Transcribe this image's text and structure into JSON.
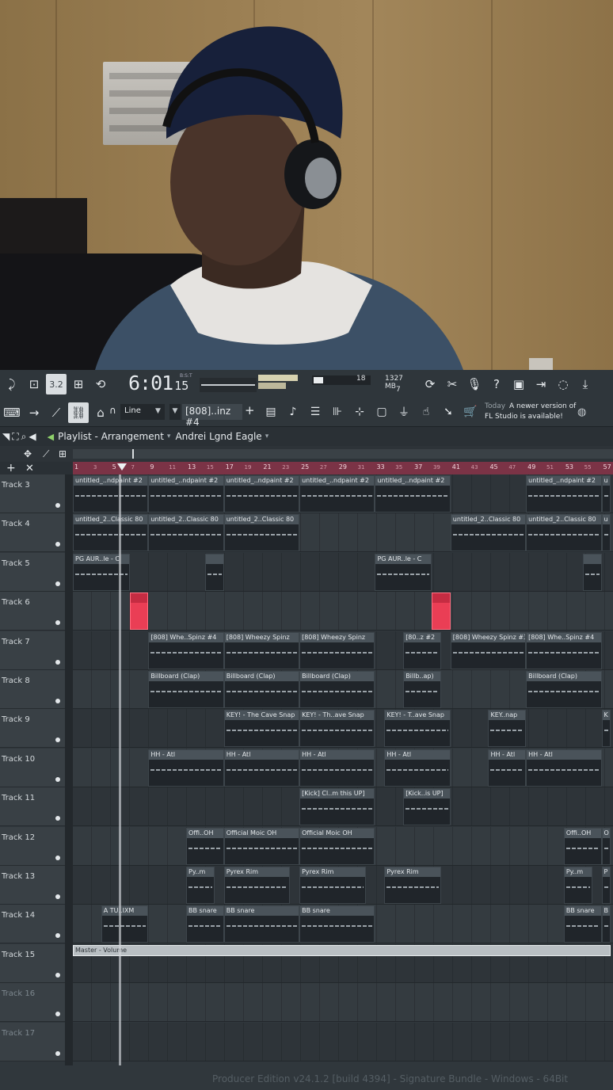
{
  "toolbar": {
    "time_main": "6:01",
    "time_sub": "15",
    "time_tag": "B:S:T",
    "cpu_voices": "18",
    "ram": "1327 MB",
    "poly": "7",
    "snap": "Line",
    "pattern": "[808]..inz #4",
    "news_date": "Today",
    "news_text": "A newer version of FL Studio is available!"
  },
  "playlist": {
    "title": "Playlist - Arrangement",
    "pattern_name": "Andrei Lgnd Eagle",
    "status": "Producer Edition v24.1.2 [build 4394] - Signature Bundle - Windows - 64Bit"
  },
  "ruler": [
    "1",
    "3",
    "5",
    "7",
    "9",
    "11",
    "13",
    "15",
    "17",
    "19",
    "21",
    "23",
    "25",
    "27",
    "29",
    "31",
    "33",
    "35",
    "37",
    "39",
    "41",
    "43",
    "45",
    "47",
    "49",
    "51",
    "53",
    "55",
    "57"
  ],
  "tracks": [
    {
      "name": "Track 3"
    },
    {
      "name": "Track 4"
    },
    {
      "name": "Track 5"
    },
    {
      "name": "Track 6"
    },
    {
      "name": "Track 7"
    },
    {
      "name": "Track 8"
    },
    {
      "name": "Track 9"
    },
    {
      "name": "Track 10"
    },
    {
      "name": "Track 11"
    },
    {
      "name": "Track 12"
    },
    {
      "name": "Track 13"
    },
    {
      "name": "Track 14"
    },
    {
      "name": "Track 15"
    },
    {
      "name": "Track 16"
    },
    {
      "name": "Track 17"
    }
  ],
  "clips": [
    {
      "t": 0,
      "bar": 1,
      "len": 8,
      "label": "untitled_..ndpaint #2"
    },
    {
      "t": 0,
      "bar": 9,
      "len": 8,
      "label": "untitled_..ndpaint #2"
    },
    {
      "t": 0,
      "bar": 17,
      "len": 8,
      "label": "untitled_..ndpaint #2"
    },
    {
      "t": 0,
      "bar": 25,
      "len": 8,
      "label": "untitled_..ndpaint #2"
    },
    {
      "t": 0,
      "bar": 33,
      "len": 8,
      "label": "untitled_..ndpaint #2"
    },
    {
      "t": 0,
      "bar": 49,
      "len": 8,
      "label": "untitled_..ndpaint #2"
    },
    {
      "t": 0,
      "bar": 57,
      "len": 1,
      "label": "u"
    },
    {
      "t": 1,
      "bar": 1,
      "len": 8,
      "label": "untitled_2..Classic 80"
    },
    {
      "t": 1,
      "bar": 9,
      "len": 8,
      "label": "untitled_2..Classic 80"
    },
    {
      "t": 1,
      "bar": 17,
      "len": 8,
      "label": "untitled_2..Classic 80"
    },
    {
      "t": 1,
      "bar": 41,
      "len": 8,
      "label": "untitled_2..Classic 80"
    },
    {
      "t": 1,
      "bar": 49,
      "len": 8,
      "label": "untitled_2..Classic 80"
    },
    {
      "t": 1,
      "bar": 57,
      "len": 1,
      "label": "u"
    },
    {
      "t": 2,
      "bar": 1,
      "len": 6,
      "label": "PG AUR..le - C"
    },
    {
      "t": 2,
      "bar": 15,
      "len": 2,
      "label": ""
    },
    {
      "t": 2,
      "bar": 33,
      "len": 6,
      "label": "PG AUR..le - C"
    },
    {
      "t": 2,
      "bar": 55,
      "len": 2,
      "label": ""
    },
    {
      "t": 3,
      "bar": 7,
      "len": 2,
      "label": "",
      "red": true
    },
    {
      "t": 3,
      "bar": 39,
      "len": 2,
      "label": "",
      "red": true
    },
    {
      "t": 4,
      "bar": 9,
      "len": 8,
      "label": "[808] Whe..Spinz #4"
    },
    {
      "t": 4,
      "bar": 17,
      "len": 8,
      "label": "[808] Wheezy Spinz"
    },
    {
      "t": 4,
      "bar": 25,
      "len": 8,
      "label": "[808] Wheezy Spinz"
    },
    {
      "t": 4,
      "bar": 36,
      "len": 4,
      "label": "[80..z #2"
    },
    {
      "t": 4,
      "bar": 41,
      "len": 8,
      "label": "[808] Wheezy Spinz #3"
    },
    {
      "t": 4,
      "bar": 49,
      "len": 8,
      "label": "[808] Whe..Spinz #4"
    },
    {
      "t": 5,
      "bar": 9,
      "len": 8,
      "label": "Billboard (Clap)"
    },
    {
      "t": 5,
      "bar": 17,
      "len": 8,
      "label": "Billboard (Clap)"
    },
    {
      "t": 5,
      "bar": 25,
      "len": 8,
      "label": "Billboard (Clap)"
    },
    {
      "t": 5,
      "bar": 36,
      "len": 4,
      "label": "Billb..ap)"
    },
    {
      "t": 5,
      "bar": 49,
      "len": 8,
      "label": "Billboard (Clap)"
    },
    {
      "t": 6,
      "bar": 17,
      "len": 8,
      "label": "KEY! - The Cave Snap"
    },
    {
      "t": 6,
      "bar": 25,
      "len": 8,
      "label": "KEY! - Th..ave Snap"
    },
    {
      "t": 6,
      "bar": 34,
      "len": 7,
      "label": "KEY! - T..ave Snap"
    },
    {
      "t": 6,
      "bar": 45,
      "len": 4,
      "label": "KEY..nap"
    },
    {
      "t": 6,
      "bar": 57,
      "len": 1,
      "label": "K"
    },
    {
      "t": 7,
      "bar": 9,
      "len": 8,
      "label": "HH - Atl"
    },
    {
      "t": 7,
      "bar": 17,
      "len": 8,
      "label": "HH - Atl"
    },
    {
      "t": 7,
      "bar": 25,
      "len": 8,
      "label": "HH - Atl"
    },
    {
      "t": 7,
      "bar": 34,
      "len": 7,
      "label": "HH - Atl"
    },
    {
      "t": 7,
      "bar": 45,
      "len": 4,
      "label": "HH - Atl"
    },
    {
      "t": 7,
      "bar": 49,
      "len": 8,
      "label": "HH - Atl"
    },
    {
      "t": 8,
      "bar": 25,
      "len": 8,
      "label": "[Kick] Cl..m this UP]"
    },
    {
      "t": 8,
      "bar": 36,
      "len": 5,
      "label": "[Kick..is UP]"
    },
    {
      "t": 9,
      "bar": 13,
      "len": 4,
      "label": "Offi..OH"
    },
    {
      "t": 9,
      "bar": 17,
      "len": 8,
      "label": "Official Moic OH"
    },
    {
      "t": 9,
      "bar": 25,
      "len": 8,
      "label": "Official Moic OH"
    },
    {
      "t": 9,
      "bar": 53,
      "len": 4,
      "label": "Offi..OH"
    },
    {
      "t": 9,
      "bar": 57,
      "len": 1,
      "label": "O"
    },
    {
      "t": 10,
      "bar": 13,
      "len": 3,
      "label": "Py..m"
    },
    {
      "t": 10,
      "bar": 17,
      "len": 7,
      "label": "Pyrex Rim"
    },
    {
      "t": 10,
      "bar": 25,
      "len": 7,
      "label": "Pyrex Rim"
    },
    {
      "t": 10,
      "bar": 34,
      "len": 6,
      "label": "Pyrex Rim"
    },
    {
      "t": 10,
      "bar": 53,
      "len": 3,
      "label": "Py..m"
    },
    {
      "t": 10,
      "bar": 57,
      "len": 1,
      "label": "P"
    },
    {
      "t": 11,
      "bar": 4,
      "len": 5,
      "label": "A TU..IXM"
    },
    {
      "t": 11,
      "bar": 13,
      "len": 4,
      "label": "BB snare"
    },
    {
      "t": 11,
      "bar": 17,
      "len": 8,
      "label": "BB snare"
    },
    {
      "t": 11,
      "bar": 25,
      "len": 8,
      "label": "BB snare"
    },
    {
      "t": 11,
      "bar": 53,
      "len": 4,
      "label": "BB snare"
    },
    {
      "t": 11,
      "bar": 57,
      "len": 1,
      "label": "B"
    },
    {
      "t": 12,
      "bar": 1,
      "len": 57,
      "label": "Master - Volume",
      "master": true
    }
  ]
}
